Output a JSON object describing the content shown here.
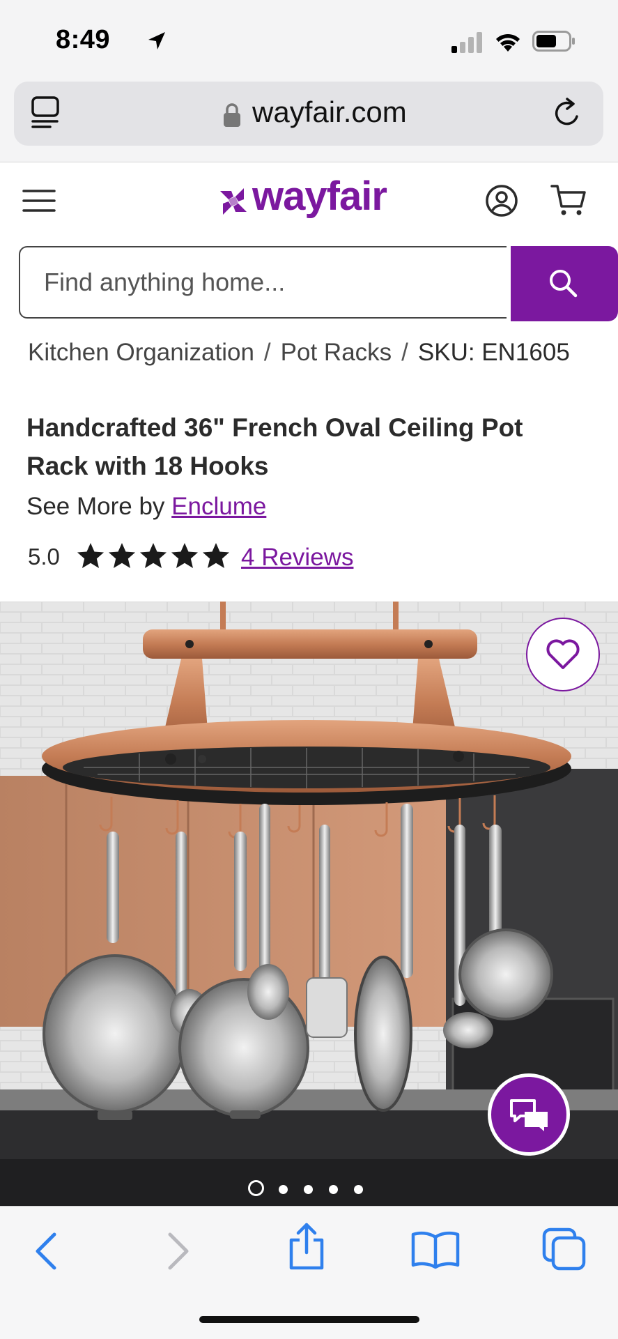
{
  "status_bar": {
    "time": "8:49"
  },
  "browser": {
    "url": "wayfair.com"
  },
  "header": {
    "logo_text": "wayfair",
    "brand_color": "#7b189f"
  },
  "search": {
    "placeholder": "Find anything home..."
  },
  "breadcrumb": {
    "items": [
      "Kitchen Organization",
      "Pot Racks",
      "SKU: EN1605"
    ],
    "separator": "/"
  },
  "product": {
    "title": "Handcrafted 36\" French Oval Ceiling Pot Rack with 18 Hooks",
    "see_more_prefix": "See More by",
    "brand": "Enclume",
    "rating": "5.0",
    "stars": 5,
    "reviews_label": "4 Reviews"
  },
  "gallery": {
    "image_count": 5,
    "active_index": 0
  },
  "icons": {
    "status": [
      "location-arrow-icon",
      "cellular-signal-icon",
      "wifi-icon",
      "battery-icon"
    ],
    "browser": [
      "tab-overview-icon",
      "lock-icon",
      "reload-icon"
    ],
    "header": [
      "hamburger-menu-icon",
      "account-icon",
      "cart-icon",
      "search-icon"
    ],
    "product": [
      "heart-icon",
      "chat-icon",
      "star-icon"
    ],
    "toolbar": [
      "back-arrow-icon",
      "forward-arrow-icon",
      "share-icon",
      "bookmarks-icon",
      "tabs-icon"
    ]
  }
}
